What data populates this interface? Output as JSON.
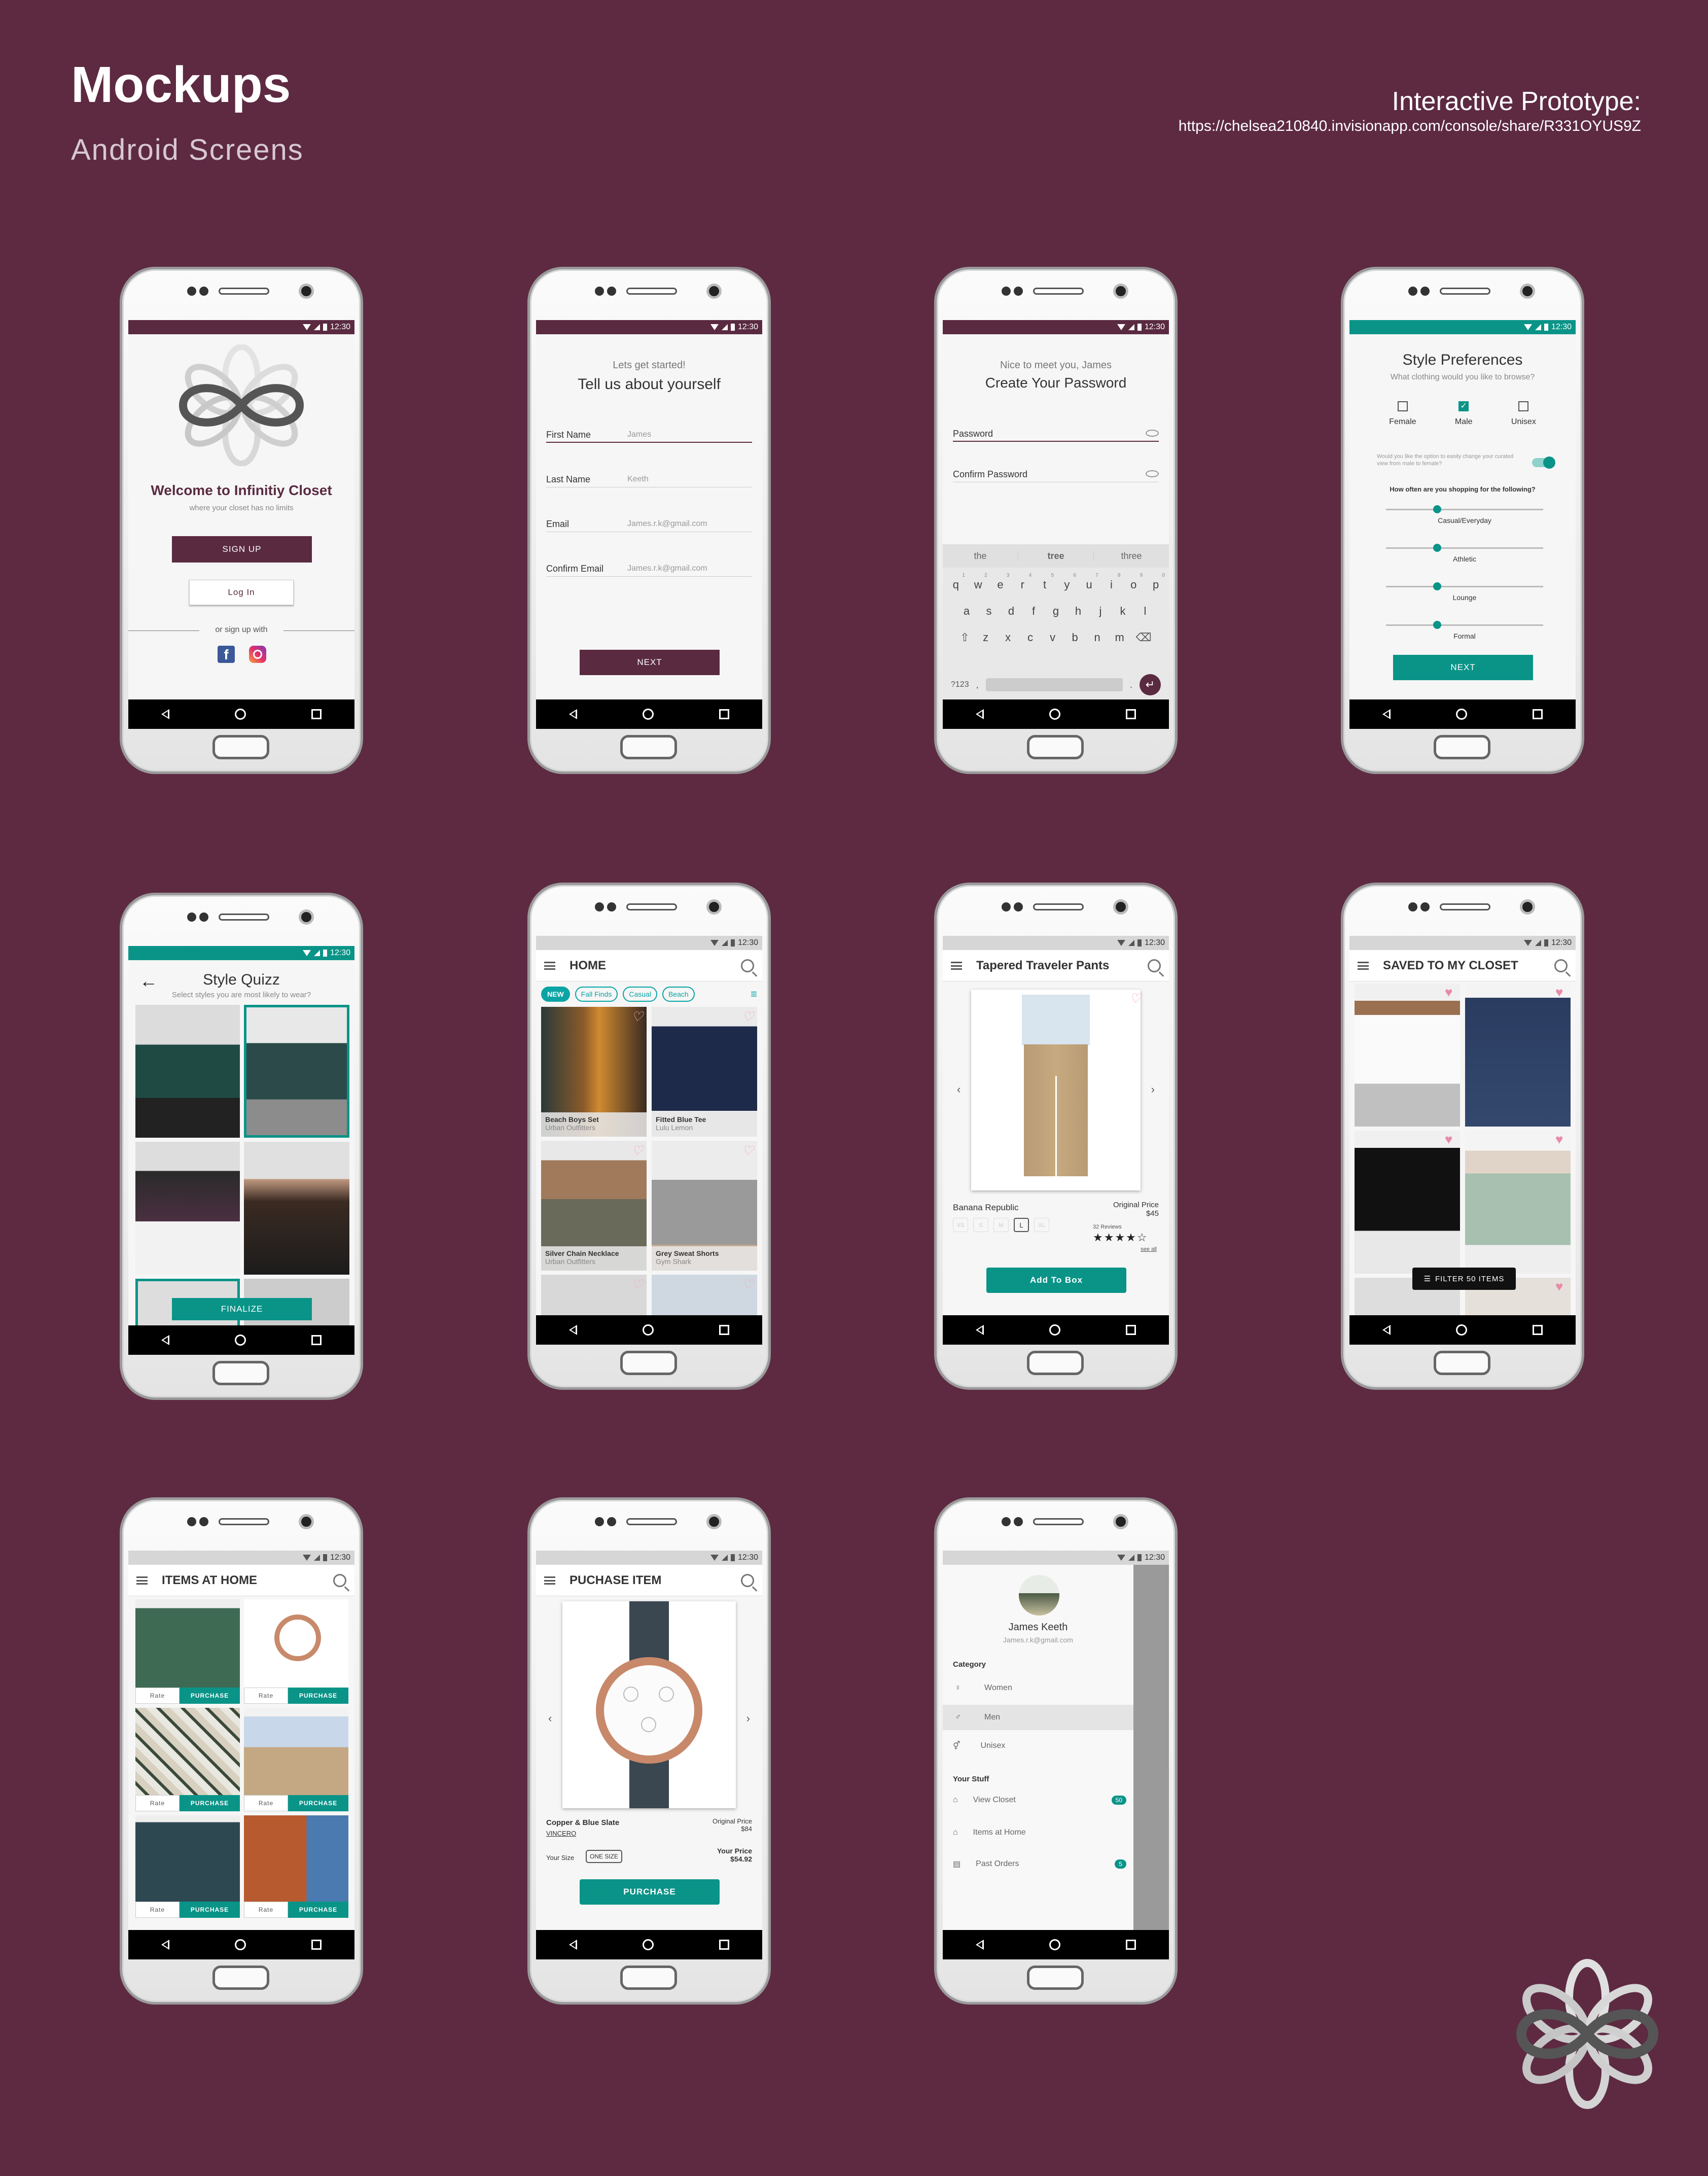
{
  "header": {
    "title": "Mockups",
    "subtitle": "Android  Screens",
    "prototype_label": "Interactive Prototype:",
    "prototype_url": "https://chelsea210840.invisionapp.com/console/share/R331OYUS9Z"
  },
  "status": {
    "time": "12:30"
  },
  "colors": {
    "brand": "#5a2a40",
    "accent": "#0a9488",
    "background": "#5d2a42"
  },
  "welcome": {
    "title": "Welcome to Infinitiy Closet",
    "tagline": "where your closet has no limits",
    "signup_label": "SIGN UP",
    "login_label": "Log In",
    "or_label": "or sign up with",
    "social_icons": [
      "facebook-icon",
      "instagram-icon"
    ]
  },
  "signup": {
    "kicker": "Lets get started!",
    "title": "Tell us about yourself",
    "fields": [
      {
        "label": "First Name",
        "value": "James"
      },
      {
        "label": "Last Name",
        "value": "Keeth"
      },
      {
        "label": "Email",
        "value": "James.r.k@gmail.com"
      },
      {
        "label": "Confirm Email",
        "value": "James.r.k@gmail.com"
      }
    ],
    "next_label": "NEXT"
  },
  "password": {
    "kicker": "Nice to meet you, James",
    "title": "Create Your Password",
    "password_label": "Password",
    "confirm_label": "Confirm Password",
    "suggestions": [
      "the",
      "tree",
      "three"
    ],
    "keyboard_numbers": [
      "1",
      "2",
      "3",
      "4",
      "5",
      "6",
      "7",
      "8",
      "9",
      "0"
    ],
    "row1": [
      "q",
      "w",
      "e",
      "r",
      "t",
      "y",
      "u",
      "i",
      "o",
      "p"
    ],
    "row2": [
      "a",
      "s",
      "d",
      "f",
      "g",
      "h",
      "j",
      "k",
      "l"
    ],
    "row3": [
      "z",
      "x",
      "c",
      "v",
      "b",
      "n",
      "m"
    ],
    "sym_label": "?123",
    "comma": ",",
    "period": "."
  },
  "prefs": {
    "title": "Style Preferences",
    "question": "What clothing would you like to browse?",
    "options": [
      {
        "label": "Female",
        "checked": false
      },
      {
        "label": "Male",
        "checked": true
      },
      {
        "label": "Unisex",
        "checked": false
      }
    ],
    "toggle_text": "Would you like the option to easily change your curated view from male to female?",
    "toggle_on": true,
    "how_often": "How often are you shopping for the following?",
    "sliders": [
      {
        "label": "Casual/Everyday",
        "level": 0.35
      },
      {
        "label": "Athletic",
        "level": 0.35
      },
      {
        "label": "Lounge",
        "level": 0.35
      },
      {
        "label": "Formal",
        "level": 0.35
      }
    ],
    "next_label": "NEXT"
  },
  "quiz": {
    "title": "Style Quizz",
    "subtitle": "Select styles you are most likely to wear?",
    "finalize_label": "FINALIZE"
  },
  "home": {
    "title": "HOME",
    "chips": [
      "NEW",
      "Fall Finds",
      "Casual",
      "Beach"
    ],
    "products": [
      {
        "name": "Beach Boys Set",
        "brand": "Urban Outfitters"
      },
      {
        "name": "Fitted Blue Tee",
        "brand": "Lulu Lemon"
      },
      {
        "name": "Silver Chain Necklace",
        "brand": "Urban Outfitters"
      },
      {
        "name": "Grey Sweat Shorts",
        "brand": "Gym Shark"
      }
    ]
  },
  "product": {
    "title": "Tapered Traveler Pants",
    "brand": "Banana Republic",
    "price_label": "Original Price",
    "price": "$45",
    "sizes": [
      "XS",
      "S",
      "M",
      "L",
      "XL"
    ],
    "selected_size": "L",
    "reviews": "32 Reviews",
    "rating": 4,
    "see_all": "see all",
    "add_label": "Add To Box"
  },
  "saved": {
    "title": "SAVED TO MY CLOSET",
    "filter_label": "FILTER 50 ITEMS"
  },
  "items_home": {
    "title": "ITEMS AT HOME",
    "rate_label": "Rate",
    "purchase_label": "PURCHASE"
  },
  "purchase": {
    "title": "PUCHASE ITEM",
    "name": "Copper & Blue Slate",
    "brand": "VINCERO",
    "orig_label": "Original Price",
    "orig_price": "$84",
    "your_label": "Your Price",
    "your_price": "$54.92",
    "size_label": "Your Size",
    "size_value": "ONE SIZE",
    "purchase_label": "PURCHASE"
  },
  "drawer": {
    "name": "James Keeth",
    "email": "James.r.k@gmail.com",
    "category_label": "Category",
    "categories": [
      "Women",
      "Men",
      "Unisex"
    ],
    "selected": "Men",
    "stuff_label": "Your Stuff",
    "stuff": [
      {
        "label": "View Closet",
        "badge": "50"
      },
      {
        "label": "Items at Home",
        "badge": ""
      },
      {
        "label": "Past Orders",
        "badge": "5"
      }
    ]
  }
}
